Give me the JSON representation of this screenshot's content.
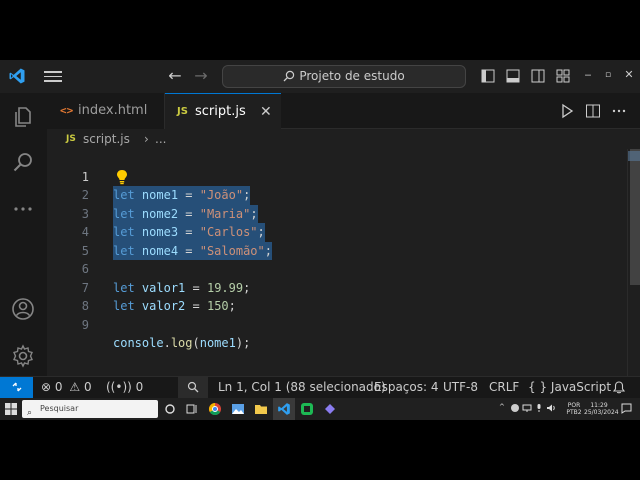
{
  "titlebar": {
    "search_text": "Projeto de estudo",
    "controls": [
      "minimize-icon",
      "maximize-icon",
      "close-icon"
    ]
  },
  "activitybar": {
    "items": [
      "files-icon",
      "search-icon",
      "more-icon"
    ],
    "bottom": [
      "account-icon",
      "settings-gear-icon"
    ]
  },
  "tabs": [
    {
      "icon_text": "<>",
      "label": "index.html",
      "active": false
    },
    {
      "icon_text": "JS",
      "label": "script.js",
      "active": true,
      "close": "✕"
    }
  ],
  "breadcrumbs": {
    "icon_text": "JS",
    "file": "script.js",
    "sep": "›",
    "more": "..."
  },
  "editor": {
    "line_numbers": [
      "1",
      "2",
      "3",
      "4",
      "5",
      "6",
      "7",
      "8",
      "9"
    ],
    "lines": [
      {
        "kw": "let",
        "var": "nome1",
        "op": " = ",
        "str": "\"João\"",
        "end": ";"
      },
      {
        "kw": "let",
        "var": "nome2",
        "op": " = ",
        "str": "\"Maria\"",
        "end": ";"
      },
      {
        "kw": "let",
        "var": "nome3",
        "op": " = ",
        "str": "\"Carlos\"",
        "end": ";"
      },
      {
        "kw": "let",
        "var": "nome4",
        "op": " = ",
        "str": "\"Salomão\"",
        "end": ";"
      },
      {
        "kw": "let",
        "var": "valor1",
        "op": " = ",
        "num": "19.99",
        "end": ";"
      },
      {
        "kw": "let",
        "var": "valor2",
        "op": " = ",
        "num": "150",
        "end": ";"
      },
      {
        "obj": "console",
        "dot": ".",
        "fn": "log",
        "open": "(",
        "arg": "nome1",
        "close": ");"
      }
    ]
  },
  "statusbar": {
    "errors": "0",
    "warnings": "0",
    "ports": "0",
    "position": "Ln 1, Col 1 (88 selecionado)",
    "spaces": "Espaços: 4",
    "encoding": "UTF-8",
    "eol": "CRLF",
    "language_brace": "{ }",
    "language": "JavaScript"
  },
  "taskbar": {
    "search_placeholder": "Pesquisar",
    "lang_top": "POR",
    "lang_bottom": "PTB2",
    "time": "11:29",
    "date": "25/03/2024"
  },
  "colors": {
    "accent": "#0078d4",
    "editor_bg": "#1f1f1f",
    "selection": "#264f78",
    "keyword": "#569cd6",
    "variable": "#9cdcfe",
    "string": "#ce9178",
    "number": "#b5cea8",
    "function": "#dcdcaa"
  }
}
